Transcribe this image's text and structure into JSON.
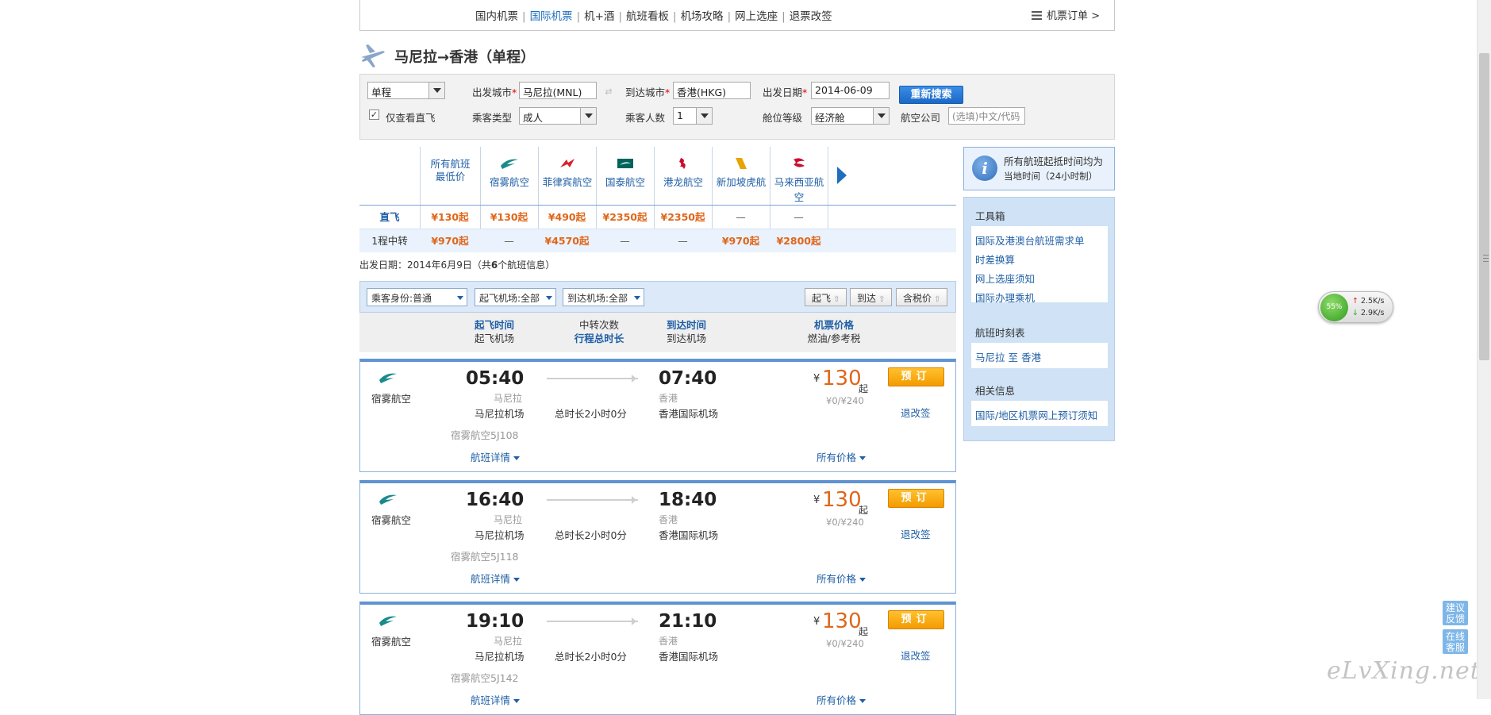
{
  "nav": {
    "links": [
      "国内机票",
      "国际机票",
      "机+酒",
      "航班看板",
      "机场攻略",
      "网上选座",
      "退票改签"
    ],
    "active_index": 1,
    "orders": "机票订单 >"
  },
  "title": "马尼拉→香港（单程）",
  "search": {
    "trip_type": "单程",
    "dep_city_label": "出发城市",
    "dep_city": "马尼拉(MNL)",
    "arr_city_label": "到达城市",
    "arr_city": "香港(HKG)",
    "date_label": "出发日期",
    "date": "2014-06-09",
    "search_button": "重新搜索",
    "direct_only_label": "仅查看直飞",
    "direct_only_checked": true,
    "passenger_type_label": "乘客类型",
    "passenger_type": "成人",
    "passenger_count_label": "乘客人数",
    "passenger_count": "1",
    "cabin_label": "舱位等级",
    "cabin": "经济舱",
    "airline_label": "航空公司",
    "airline_placeholder": "(选填)中文/代码"
  },
  "matrix": {
    "first_header": [
      "所有航班",
      "最低价"
    ],
    "airlines": [
      {
        "name": "宿雾航空",
        "logo": "cebu-pacific-logo",
        "color": "#1a8a8a"
      },
      {
        "name": "菲律宾航空",
        "logo": "philippine-airlines-logo",
        "color": "#d8232a"
      },
      {
        "name": "国泰航空",
        "logo": "cathay-pacific-logo",
        "color": "#00645a"
      },
      {
        "name": "港龙航空",
        "logo": "dragonair-logo",
        "color": "#c8102e"
      },
      {
        "name": "新加坡虎航",
        "logo": "tigerair-logo",
        "color": "#e8a400"
      },
      {
        "name": "马来西亚航空",
        "logo": "malaysia-airlines-logo",
        "color": "#c8102e"
      }
    ],
    "rows": [
      {
        "label": "直飞",
        "cells": [
          "¥130起",
          "¥130起",
          "¥490起",
          "¥2350起",
          "¥2350起",
          "—",
          "—"
        ]
      },
      {
        "label": "1程中转",
        "cells": [
          "¥970起",
          "—",
          "¥4570起",
          "—",
          "—",
          "¥970起",
          "¥2800起"
        ]
      }
    ]
  },
  "dep_info": {
    "prefix": "出发日期：",
    "date": "2014年6月9日（共",
    "count": "6",
    "suffix": "个航班信息）"
  },
  "filters": {
    "passenger": "乘客身份:普通",
    "dep_airport": "起飞机场:全部",
    "arr_airport": "到达机场:全部",
    "sort": [
      "起飞",
      "到达",
      "含税价"
    ]
  },
  "columns": {
    "dep": [
      "起飞时间",
      "起飞机场"
    ],
    "transfer": [
      "中转次数",
      "行程总时长"
    ],
    "arr": [
      "到达时间",
      "到达机场"
    ],
    "price": [
      "机票价格",
      "燃油/参考税"
    ]
  },
  "flights": [
    {
      "airline": "宿雾航空",
      "dep_time": "05:40",
      "dep_city": "马尼拉",
      "dep_airport": "马尼拉机场",
      "flight_no": "宿雾航空5J108",
      "duration": "总时长2小时0分",
      "arr_time": "07:40",
      "arr_city": "香港",
      "arr_airport": "香港国际机场",
      "currency": "¥",
      "price": "130",
      "price_suffix": "起",
      "tax": "¥0/¥240",
      "book": "预订",
      "refund": "退改签",
      "details": "航班详情",
      "all_prices": "所有价格"
    },
    {
      "airline": "宿雾航空",
      "dep_time": "16:40",
      "dep_city": "马尼拉",
      "dep_airport": "马尼拉机场",
      "flight_no": "宿雾航空5J118",
      "duration": "总时长2小时0分",
      "arr_time": "18:40",
      "arr_city": "香港",
      "arr_airport": "香港国际机场",
      "currency": "¥",
      "price": "130",
      "price_suffix": "起",
      "tax": "¥0/¥240",
      "book": "预订",
      "refund": "退改签",
      "details": "航班详情",
      "all_prices": "所有价格"
    },
    {
      "airline": "宿雾航空",
      "dep_time": "19:10",
      "dep_city": "马尼拉",
      "dep_airport": "马尼拉机场",
      "flight_no": "宿雾航空5J142",
      "duration": "总时长2小时0分",
      "arr_time": "21:10",
      "arr_city": "香港",
      "arr_airport": "香港国际机场",
      "currency": "¥",
      "price": "130",
      "price_suffix": "起",
      "tax": "¥0/¥240",
      "book": "预订",
      "refund": "退改签",
      "details": "航班详情",
      "all_prices": "所有价格"
    }
  ],
  "sidebar": {
    "notice_line1": "所有航班起抵时间均为",
    "notice_line2": "当地时间（24小时制）",
    "toolbox_title": "工具箱",
    "toolbox_links": [
      "国际及港澳台航班需求单",
      "时差换算",
      "网上选座须知",
      "国际办理乘机"
    ],
    "schedule_title": "航班时刻表",
    "schedule_link": "马尼拉 至 香港",
    "related_title": "相关信息",
    "related_link": "国际/地区机票网上预订须知"
  },
  "net_widget": {
    "percent": "55%",
    "up": "2.5K/s",
    "down": "2.9K/s"
  },
  "float_buttons": [
    "建议反馈",
    "在线客服"
  ],
  "watermark": "eLvXing.net"
}
